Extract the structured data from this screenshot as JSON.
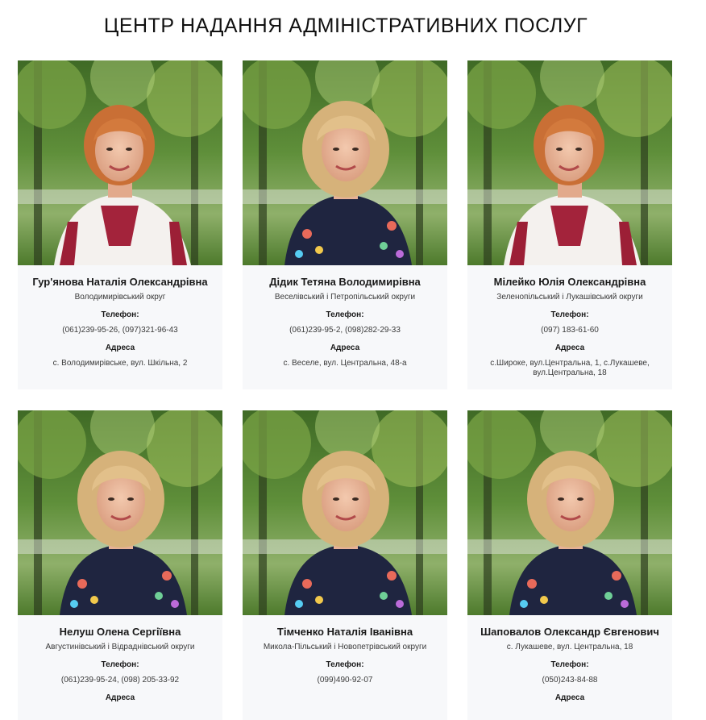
{
  "page": {
    "title": "ЦЕНТР НАДАННЯ АДМІНІСТРАТИВНИХ ПОСЛУГ"
  },
  "labels": {
    "phone": "Телефон:",
    "address": "Адреса"
  },
  "cards": [
    {
      "name": "Гур'янова Наталія Олександрівна",
      "district": "Володимирівський округ",
      "phone": "(061)239-95-26, (097)321-96-43",
      "address": "с. Володимирівське, вул. Шкільна, 2",
      "photo": "redhead-white-vyshyvanka"
    },
    {
      "name": "Дідик Тетяна Володимирівна",
      "district": "Веселівський і Петропільський округи",
      "phone": "(061)239-95-2, (098)282-29-33",
      "address": "с. Веселе, вул. Центральна, 48-а",
      "photo": "blonde-dark-vyshyvanka"
    },
    {
      "name": "Мілейко Юлія Олександрівна",
      "district": "Зеленопільський і Лукашівський округи",
      "phone": "(097) 183-61-60",
      "address": "с.Широке, вул.Центральна, 1, с.Лукашеве, вул.Центральна, 18",
      "photo": "redhead-white-vyshyvanka"
    },
    {
      "name": "Нелуш Олена Сергіївна",
      "district": "Августинівський і Відраднівський округи",
      "phone": "(061)239-95-24, (098) 205-33-92",
      "address": "",
      "photo": "blonde-dark-vyshyvanka"
    },
    {
      "name": "Тімченко Наталія Іванівна",
      "district": "Микола-Пільський і Новопетрівський округи",
      "phone": "(099)490-92-07",
      "address": "",
      "photo": "blonde-dark-vyshyvanka"
    },
    {
      "name": "Шаповалов Олександр Євгенович",
      "district": "с. Лукашеве, вул. Центральна, 18",
      "phone": "(050)243-84-88",
      "address": "",
      "photo": "blonde-dark-vyshyvanka"
    }
  ]
}
